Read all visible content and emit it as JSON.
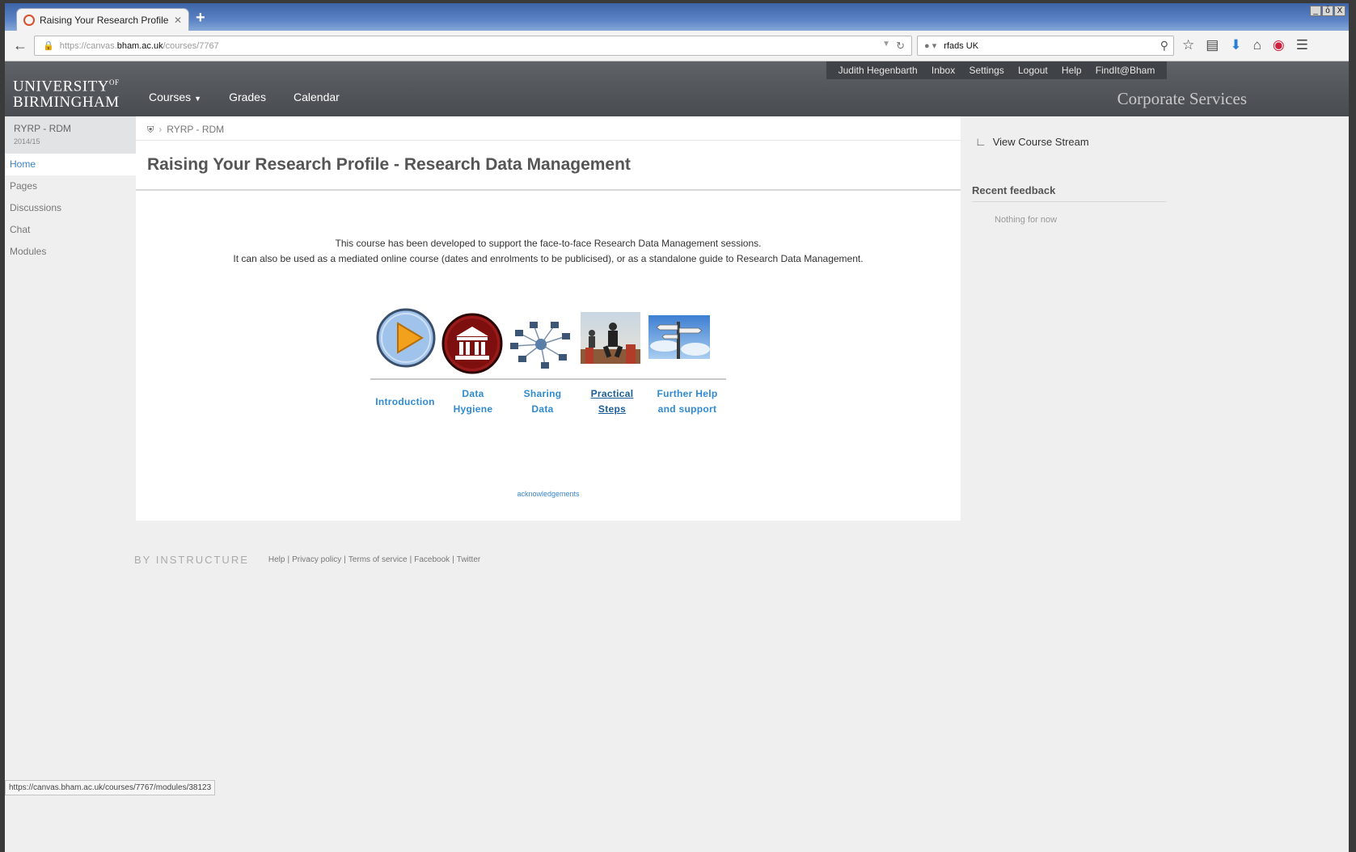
{
  "browser": {
    "tab_title": "Raising Your Research Profile ...",
    "new_tab": "+",
    "url_prefix": "https://canvas.",
    "url_host": "bham.ac.uk",
    "url_path": "/courses/7767",
    "search_value": "rfads UK",
    "status_url": "https://canvas.bham.ac.uk/courses/7767/modules/38123",
    "window_buttons": [
      "_",
      "ȱ",
      "X"
    ]
  },
  "header": {
    "logo_line1": "UNIVERSITY",
    "logo_sup": "OF",
    "logo_line2": "BIRMINGHAM",
    "nav": [
      "Courses",
      "Grades",
      "Calendar"
    ],
    "user_nav": [
      "Judith Hegenbarth",
      "Inbox",
      "Settings",
      "Logout",
      "Help",
      "FindIt@Bham"
    ],
    "corporate": "Corporate Services"
  },
  "course": {
    "code": "RYRP - RDM",
    "term": "2014/15",
    "nav": [
      "Home",
      "Pages",
      "Discussions",
      "Chat",
      "Modules"
    ]
  },
  "main": {
    "breadcrumb": "RYRP - RDM",
    "title": "Raising Your Research Profile - Research Data Management",
    "intro_line1": "This course has been developed to support the face-to-face Research Data Management sessions.",
    "intro_line2": "It can also be used as a mediated online course (dates and enrolments to be publicised), or as a standalone guide to Research Data Management.",
    "modules": [
      {
        "line1": "Introduction",
        "line2": "",
        "icon": "play-icon"
      },
      {
        "line1": "Data",
        "line2": "Hygiene",
        "icon": "museum-icon"
      },
      {
        "line1": "Sharing",
        "line2": "Data",
        "icon": "network-icon"
      },
      {
        "line1": "Practical",
        "line2": "Steps",
        "icon": "business-photo-icon"
      },
      {
        "line1": "Further Help",
        "line2": "and support",
        "icon": "signpost-photo-icon"
      }
    ],
    "acknowledgements": "acknowledgements"
  },
  "sidebar": {
    "stream_link": "View Course Stream",
    "recent_feedback": "Recent feedback",
    "nothing": "Nothing for now"
  },
  "footer": {
    "brand": "BY INSTRUCTURE",
    "links": [
      "Help",
      "Privacy policy",
      "Terms of service",
      "Facebook",
      "Twitter"
    ]
  },
  "colors": {
    "header": "#54585d",
    "link_blue": "#2e8bd1",
    "module_red": "#9a1a1a",
    "play_blue": "#9fc3ea",
    "play_orange": "#f2a11c"
  }
}
